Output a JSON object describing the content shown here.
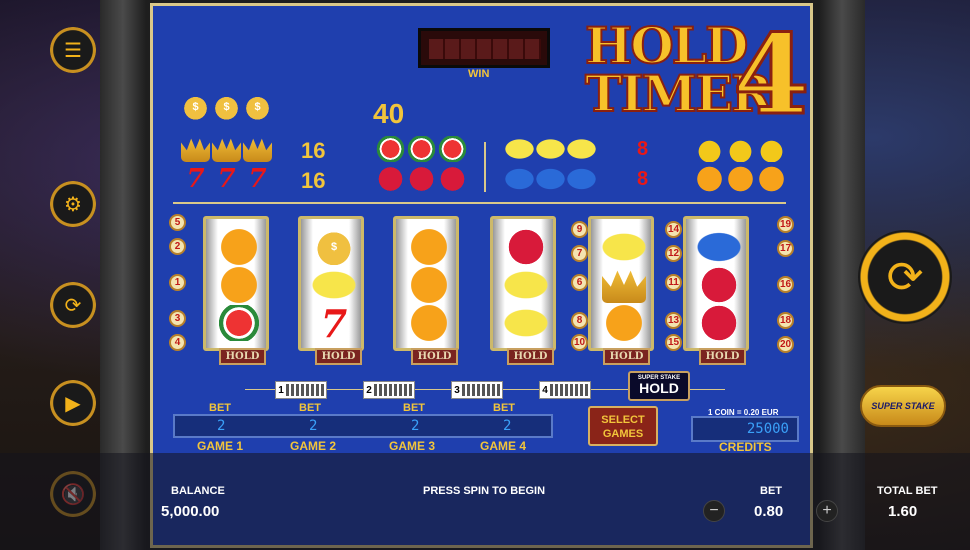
{
  "win": {
    "label": "WIN"
  },
  "logo": {
    "line1": "HOLD",
    "line2": "TIMER",
    "number": "4"
  },
  "paytable": {
    "row1": {
      "symbol": "money-bag",
      "pay": "40"
    },
    "row2a": {
      "symbol": "crown",
      "pay": "16"
    },
    "row2b": {
      "symbol": "watermelon",
      "pay": ""
    },
    "row2c": {
      "symbol": "lemon",
      "pay": "8"
    },
    "row2d": {
      "symbol": "orange-lemon",
      "pay": ""
    },
    "row3a": {
      "symbol": "seven",
      "glyph": "7",
      "pay": "16"
    },
    "row3b": {
      "symbol": "raspberry",
      "pay": ""
    },
    "row3c": {
      "symbol": "plum",
      "pay": "8"
    },
    "row3d": {
      "symbol": "orange",
      "pay": ""
    }
  },
  "reels": {
    "hold_label": "HOLD"
  },
  "line_markers_left": [
    "5",
    "2",
    "1",
    "3",
    "4"
  ],
  "line_markers_mid_left": [
    "9",
    "7",
    "6",
    "8",
    "10"
  ],
  "line_markers_mid_right": [
    "14",
    "12",
    "11",
    "13",
    "15"
  ],
  "line_markers_right": [
    "19",
    "17",
    "16",
    "18",
    "20"
  ],
  "games": {
    "meters": [
      "1",
      "2",
      "3",
      "4"
    ],
    "bet_label": "BET",
    "bets": [
      "2",
      "2",
      "2",
      "2"
    ],
    "game_labels": [
      "GAME 1",
      "GAME 2",
      "GAME 3",
      "GAME 4"
    ]
  },
  "super_stake_hold": {
    "small": "SUPER STAKE",
    "big": "HOLD"
  },
  "select_games": {
    "line1": "SELECT",
    "line2": "GAMES"
  },
  "credits": {
    "coin_info": "1 COIN = 0.20 EUR",
    "value": "25000",
    "label": "CREDITS"
  },
  "bottom": {
    "balance_label": "BALANCE",
    "balance_value": "5,000.00",
    "message": "PRESS SPIN TO BEGIN",
    "bet_label": "BET",
    "bet_value": "0.80",
    "minus": "−",
    "plus": "+",
    "total_bet_label": "TOTAL BET",
    "total_bet_value": "1.60"
  },
  "super_stake_button": {
    "label": "SUPER STAKE"
  },
  "icons": [
    "menu-icon",
    "settings-icon",
    "autoplay-icon",
    "turbo-icon",
    "sound-muted-icon",
    "spin-icon"
  ],
  "colors": {
    "board": "#1f3fae",
    "gold": "#f2c53b",
    "red": "#e81818"
  }
}
